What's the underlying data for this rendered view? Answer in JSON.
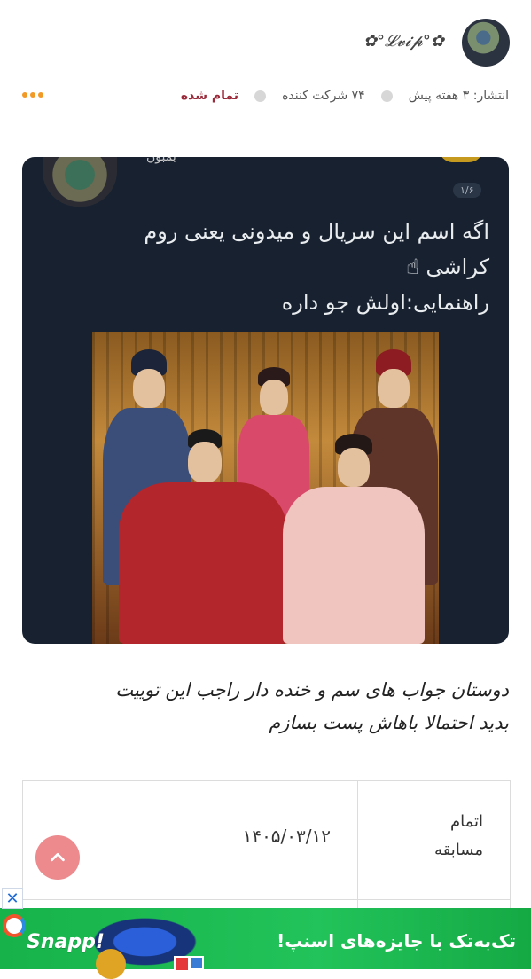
{
  "author": {
    "username": "✿°𝓛𝓿𝓲𝓹°✿"
  },
  "meta": {
    "published": "انتشار: ۳ هفته پیش",
    "participants": "۷۴ شرکت کننده",
    "status": "تمام شده"
  },
  "post": {
    "tweet_name": "بمبون",
    "tweet_badge": "۱/۶",
    "tweet_line1": "اگه اسم این سریال و میدونی یعنی روم",
    "tweet_line2": "کراشی ☝",
    "tweet_line3": "راهنمایی:اولش جو داره",
    "caption_line1": "دوستان جواب های سم و خنده دار راجب این توییت",
    "caption_line2": "بدید احتمالا باهاش پست بسازم"
  },
  "details": {
    "end_label_line1": "اتمام",
    "end_label_line2": "مسابقه",
    "end_value": "۱۴۰۵/۰۳/۱۲"
  },
  "ad": {
    "brand": "Snapp!",
    "text": "تک‌به‌تک با جایزه‌های اسنپ!",
    "close": "✕"
  },
  "colors": {
    "accent_orange": "#f29a27",
    "status_red": "#9a2a3a",
    "scroll_button": "#ec8a8e",
    "ad_green": "#22c35a"
  }
}
